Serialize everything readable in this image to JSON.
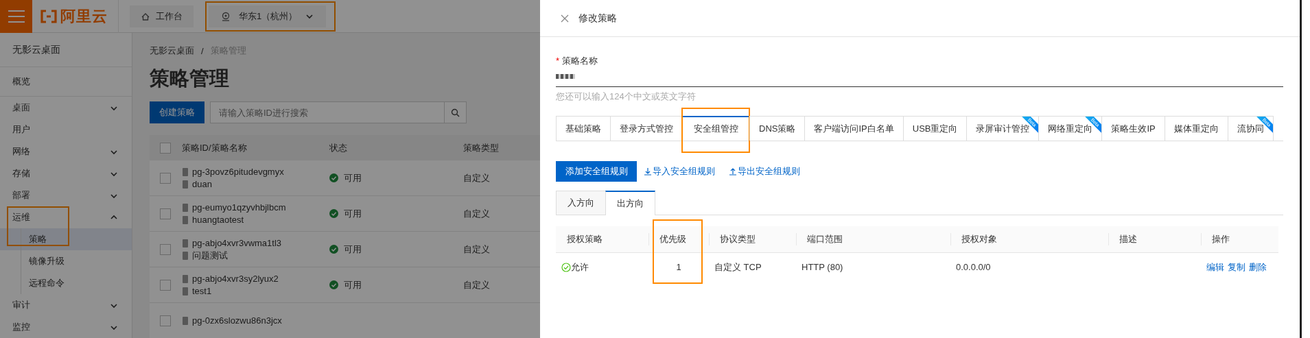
{
  "topbar": {
    "brand": "阿里云",
    "workbench": "工作台",
    "region": {
      "label": "华东1（杭州）",
      "highlighted": true
    }
  },
  "sidebar": {
    "title": "无影云桌面",
    "items": [
      {
        "label": "概览",
        "selected": false
      },
      {
        "label": "桌面",
        "expanded": false
      },
      {
        "label": "用户",
        "selected": false
      },
      {
        "label": "网络",
        "expanded": false
      },
      {
        "label": "存储",
        "expanded": false
      },
      {
        "label": "部署",
        "expanded": false
      },
      {
        "label": "运维",
        "expanded": true,
        "highlighted": true,
        "children": [
          {
            "label": "策略",
            "selected": true
          },
          {
            "label": "镜像升级",
            "selected": false
          },
          {
            "label": "远程命令",
            "selected": false
          }
        ]
      },
      {
        "label": "审计",
        "expanded": false
      },
      {
        "label": "监控",
        "expanded": false
      }
    ]
  },
  "breadcrumb": {
    "items": [
      "无影云桌面",
      "策略管理"
    ],
    "separator": "/"
  },
  "page_title": "策略管理",
  "create_button": "创建策略",
  "search": {
    "placeholder": "请输入策略ID进行搜索"
  },
  "table": {
    "all_checked": false,
    "columns": [
      "策略ID/策略名称",
      "状态",
      "策略类型"
    ],
    "rows": [
      {
        "checked": false,
        "id": "pg-3povz6pitudevgmyx",
        "name": "duan",
        "status": "可用",
        "type": "自定义"
      },
      {
        "checked": false,
        "id": "pg-eumyo1qzyvhbjlbcm",
        "name": "huangtaotest",
        "status": "可用",
        "type": "自定义"
      },
      {
        "checked": false,
        "id": "pg-abjo4xvr3vwma1tl3",
        "name": "问题测试",
        "status": "可用",
        "type": "自定义"
      },
      {
        "checked": false,
        "id": "pg-abjo4xvr3sy2lyux2",
        "name": "test1",
        "status": "可用",
        "type": "自定义"
      },
      {
        "checked": false,
        "id": "pg-0zx6slozwu86n3jcx"
      }
    ]
  },
  "drawer": {
    "title": "修改策略",
    "name_field": {
      "label": "策略名称",
      "required_marker": "*",
      "hint": "您还可以输入124个中文或英文字符"
    },
    "tabs": [
      {
        "label": "基础策略",
        "selected": false
      },
      {
        "label": "登录方式管控",
        "selected": false
      },
      {
        "label": "安全组管控",
        "selected": true,
        "highlighted": true
      },
      {
        "label": "DNS策略",
        "selected": false
      },
      {
        "label": "客户端访问IP白名单",
        "selected": false
      },
      {
        "label": "USB重定向",
        "selected": false
      },
      {
        "label": "录屏审计管控",
        "selected": false,
        "badge": "Beta"
      },
      {
        "label": "网络重定向",
        "selected": false,
        "badge": "Beta"
      },
      {
        "label": "策略生效IP",
        "selected": false
      },
      {
        "label": "媒体重定向",
        "selected": false
      },
      {
        "label": "流协同",
        "selected": false,
        "badge": "Beta"
      }
    ],
    "add_button": "添加安全组规则",
    "import_link": "导入安全组规则",
    "export_link": "导出安全组规则",
    "direction_tabs": [
      {
        "label": "入方向",
        "selected": false
      },
      {
        "label": "出方向",
        "selected": true
      }
    ],
    "rules": {
      "columns": [
        {
          "label": "授权策略"
        },
        {
          "label": "优先级",
          "highlighted": true
        },
        {
          "label": "协议类型"
        },
        {
          "label": "端口范围"
        },
        {
          "label": "授权对象"
        },
        {
          "label": "描述"
        },
        {
          "label": "操作"
        }
      ],
      "rows": [
        {
          "policy": "允许",
          "priority": "1",
          "protocol": "自定义 TCP",
          "ports": "HTTP (80)",
          "target": "0.0.0.0/0",
          "actions": [
            "编辑",
            "复制",
            "删除"
          ]
        }
      ]
    }
  }
}
